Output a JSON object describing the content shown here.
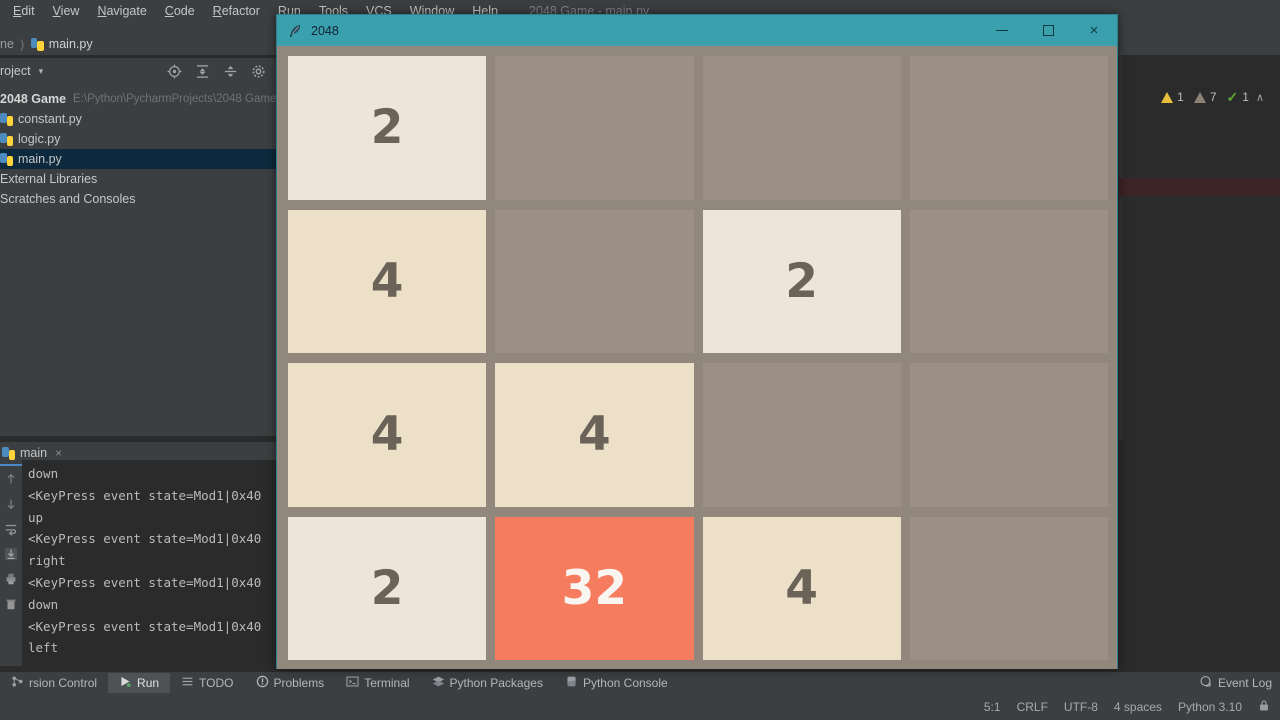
{
  "ide": {
    "menus": [
      "Edit",
      "View",
      "Navigate",
      "Code",
      "Refactor",
      "Run",
      "Tools",
      "VCS",
      "Window",
      "Help"
    ],
    "window_title": "2048 Game - main.py",
    "breadcrumb": {
      "prev": "ne",
      "separator": "⟩",
      "current": "main.py"
    },
    "project_panel": {
      "title": "roject",
      "caret": "▾",
      "tools": [
        "target-icon",
        "expand-all-icon",
        "collapse-all-icon",
        "gear-icon"
      ],
      "root_name": "2048 Game",
      "root_path": "E:\\Python\\PycharmProjects\\2048 Game",
      "items": [
        {
          "label": "constant.py",
          "icon": "python-file-icon",
          "selected": false
        },
        {
          "label": "logic.py",
          "icon": "python-file-icon",
          "selected": false
        },
        {
          "label": "main.py",
          "icon": "python-file-icon",
          "selected": true
        }
      ],
      "extras": [
        "External Libraries",
        "Scratches and Consoles"
      ]
    },
    "run_console": {
      "tab_label": "main",
      "close": "×",
      "lines": [
        "down",
        "<KeyPress event state=Mod1|0x40",
        "up",
        "<KeyPress event state=Mod1|0x40",
        "right",
        "<KeyPress event state=Mod1|0x40",
        "down",
        "<KeyPress event state=Mod1|0x40",
        "left"
      ]
    },
    "inspections": {
      "warning_count": "1",
      "weak_warning_count": "7",
      "ok_mark": "✓",
      "ok_count": "1",
      "chevron": "∧"
    },
    "toolbar_icons": [
      "run-icon",
      "debug-icon",
      "coverage-icon",
      "stop-icon",
      "search-icon",
      "update-icon"
    ],
    "tool_windows": [
      {
        "label": "rsion Control",
        "icon": "version-control-icon",
        "active": false
      },
      {
        "label": "Run",
        "icon": "run-icon",
        "active": true
      },
      {
        "label": "TODO",
        "icon": "todo-icon",
        "active": false
      },
      {
        "label": "Problems",
        "icon": "problems-icon",
        "active": false
      },
      {
        "label": "Terminal",
        "icon": "terminal-icon",
        "active": false
      },
      {
        "label": "Python Packages",
        "icon": "packages-icon",
        "active": false
      },
      {
        "label": "Python Console",
        "icon": "python-console-icon",
        "active": false
      }
    ],
    "event_log": {
      "label": "Event Log",
      "icon": "event-log-icon"
    },
    "status": {
      "caret": "5:1",
      "line_separator": "CRLF",
      "encoding": "UTF-8",
      "indent": "4 spaces",
      "interpreter": "Python 3.10"
    }
  },
  "game_window": {
    "title": "2048",
    "icon": "feather-icon",
    "controls": {
      "minimize": "–",
      "maximize": "□",
      "close": "×"
    },
    "colors": {
      "titlebar": "#3aa0ae",
      "board": "#92877d",
      "empty_cell": "#9c9086",
      "tile_2": "#eee4da",
      "tile_4": "#ede0c8",
      "tile_32": "#f67c5f",
      "text_dark": "#6b6258",
      "text_light": "#f9f6f2"
    },
    "board": [
      [
        {
          "value": "2",
          "bg": "#eee4da",
          "fg": "#6b6258"
        },
        {
          "value": "",
          "bg": "#9c9086",
          "fg": "#6b6258"
        },
        {
          "value": "",
          "bg": "#9c9086",
          "fg": "#6b6258"
        },
        {
          "value": "",
          "bg": "#9c9086",
          "fg": "#6b6258"
        }
      ],
      [
        {
          "value": "4",
          "bg": "#ede0c8",
          "fg": "#6b6258"
        },
        {
          "value": "",
          "bg": "#9c9086",
          "fg": "#6b6258"
        },
        {
          "value": "2",
          "bg": "#eee4da",
          "fg": "#6b6258"
        },
        {
          "value": "",
          "bg": "#9c9086",
          "fg": "#6b6258"
        }
      ],
      [
        {
          "value": "4",
          "bg": "#ede0c8",
          "fg": "#6b6258"
        },
        {
          "value": "4",
          "bg": "#ede0c8",
          "fg": "#6b6258"
        },
        {
          "value": "",
          "bg": "#9c9086",
          "fg": "#6b6258"
        },
        {
          "value": "",
          "bg": "#9c9086",
          "fg": "#6b6258"
        }
      ],
      [
        {
          "value": "2",
          "bg": "#eee4da",
          "fg": "#6b6258"
        },
        {
          "value": "32",
          "bg": "#f67c5f",
          "fg": "#f9f6f2"
        },
        {
          "value": "4",
          "bg": "#ede0c8",
          "fg": "#6b6258"
        },
        {
          "value": "",
          "bg": "#9c9086",
          "fg": "#6b6258"
        }
      ]
    ]
  }
}
